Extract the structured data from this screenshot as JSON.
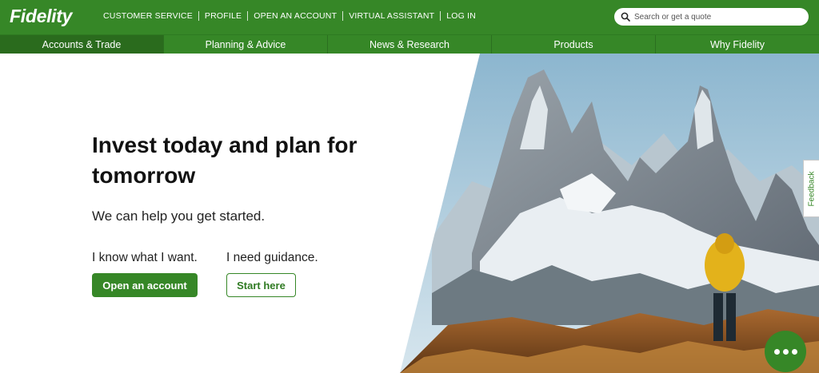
{
  "header": {
    "logo": "Fidelity",
    "utility_links": [
      {
        "label": "CUSTOMER SERVICE"
      },
      {
        "label": "PROFILE"
      },
      {
        "label": "OPEN AN ACCOUNT"
      },
      {
        "label": "VIRTUAL ASSISTANT"
      },
      {
        "label": "LOG IN"
      }
    ],
    "search": {
      "placeholder": "Search or get a quote",
      "icon": "search-icon"
    }
  },
  "nav": {
    "items": [
      {
        "label": "Accounts & Trade",
        "active": true
      },
      {
        "label": "Planning & Advice",
        "active": false
      },
      {
        "label": "News & Research",
        "active": false
      },
      {
        "label": "Products",
        "active": false
      },
      {
        "label": "Why Fidelity",
        "active": false
      }
    ]
  },
  "hero": {
    "headline": "Invest today and plan for tomorrow",
    "subhead": "We can help you get started.",
    "options": [
      {
        "label": "I know what I want.",
        "button": "Open an account",
        "style": "primary"
      },
      {
        "label": "I need guidance.",
        "button": "Start here",
        "style": "secondary"
      }
    ],
    "image": "mountain-hiker-photo"
  },
  "feedback_tab": {
    "label": "Feedback"
  },
  "chat": {
    "icon": "chat-dots-icon"
  },
  "colors": {
    "brand_green": "#368727",
    "nav_active": "#2a6b1d",
    "text_dark": "#111111",
    "white": "#ffffff"
  }
}
